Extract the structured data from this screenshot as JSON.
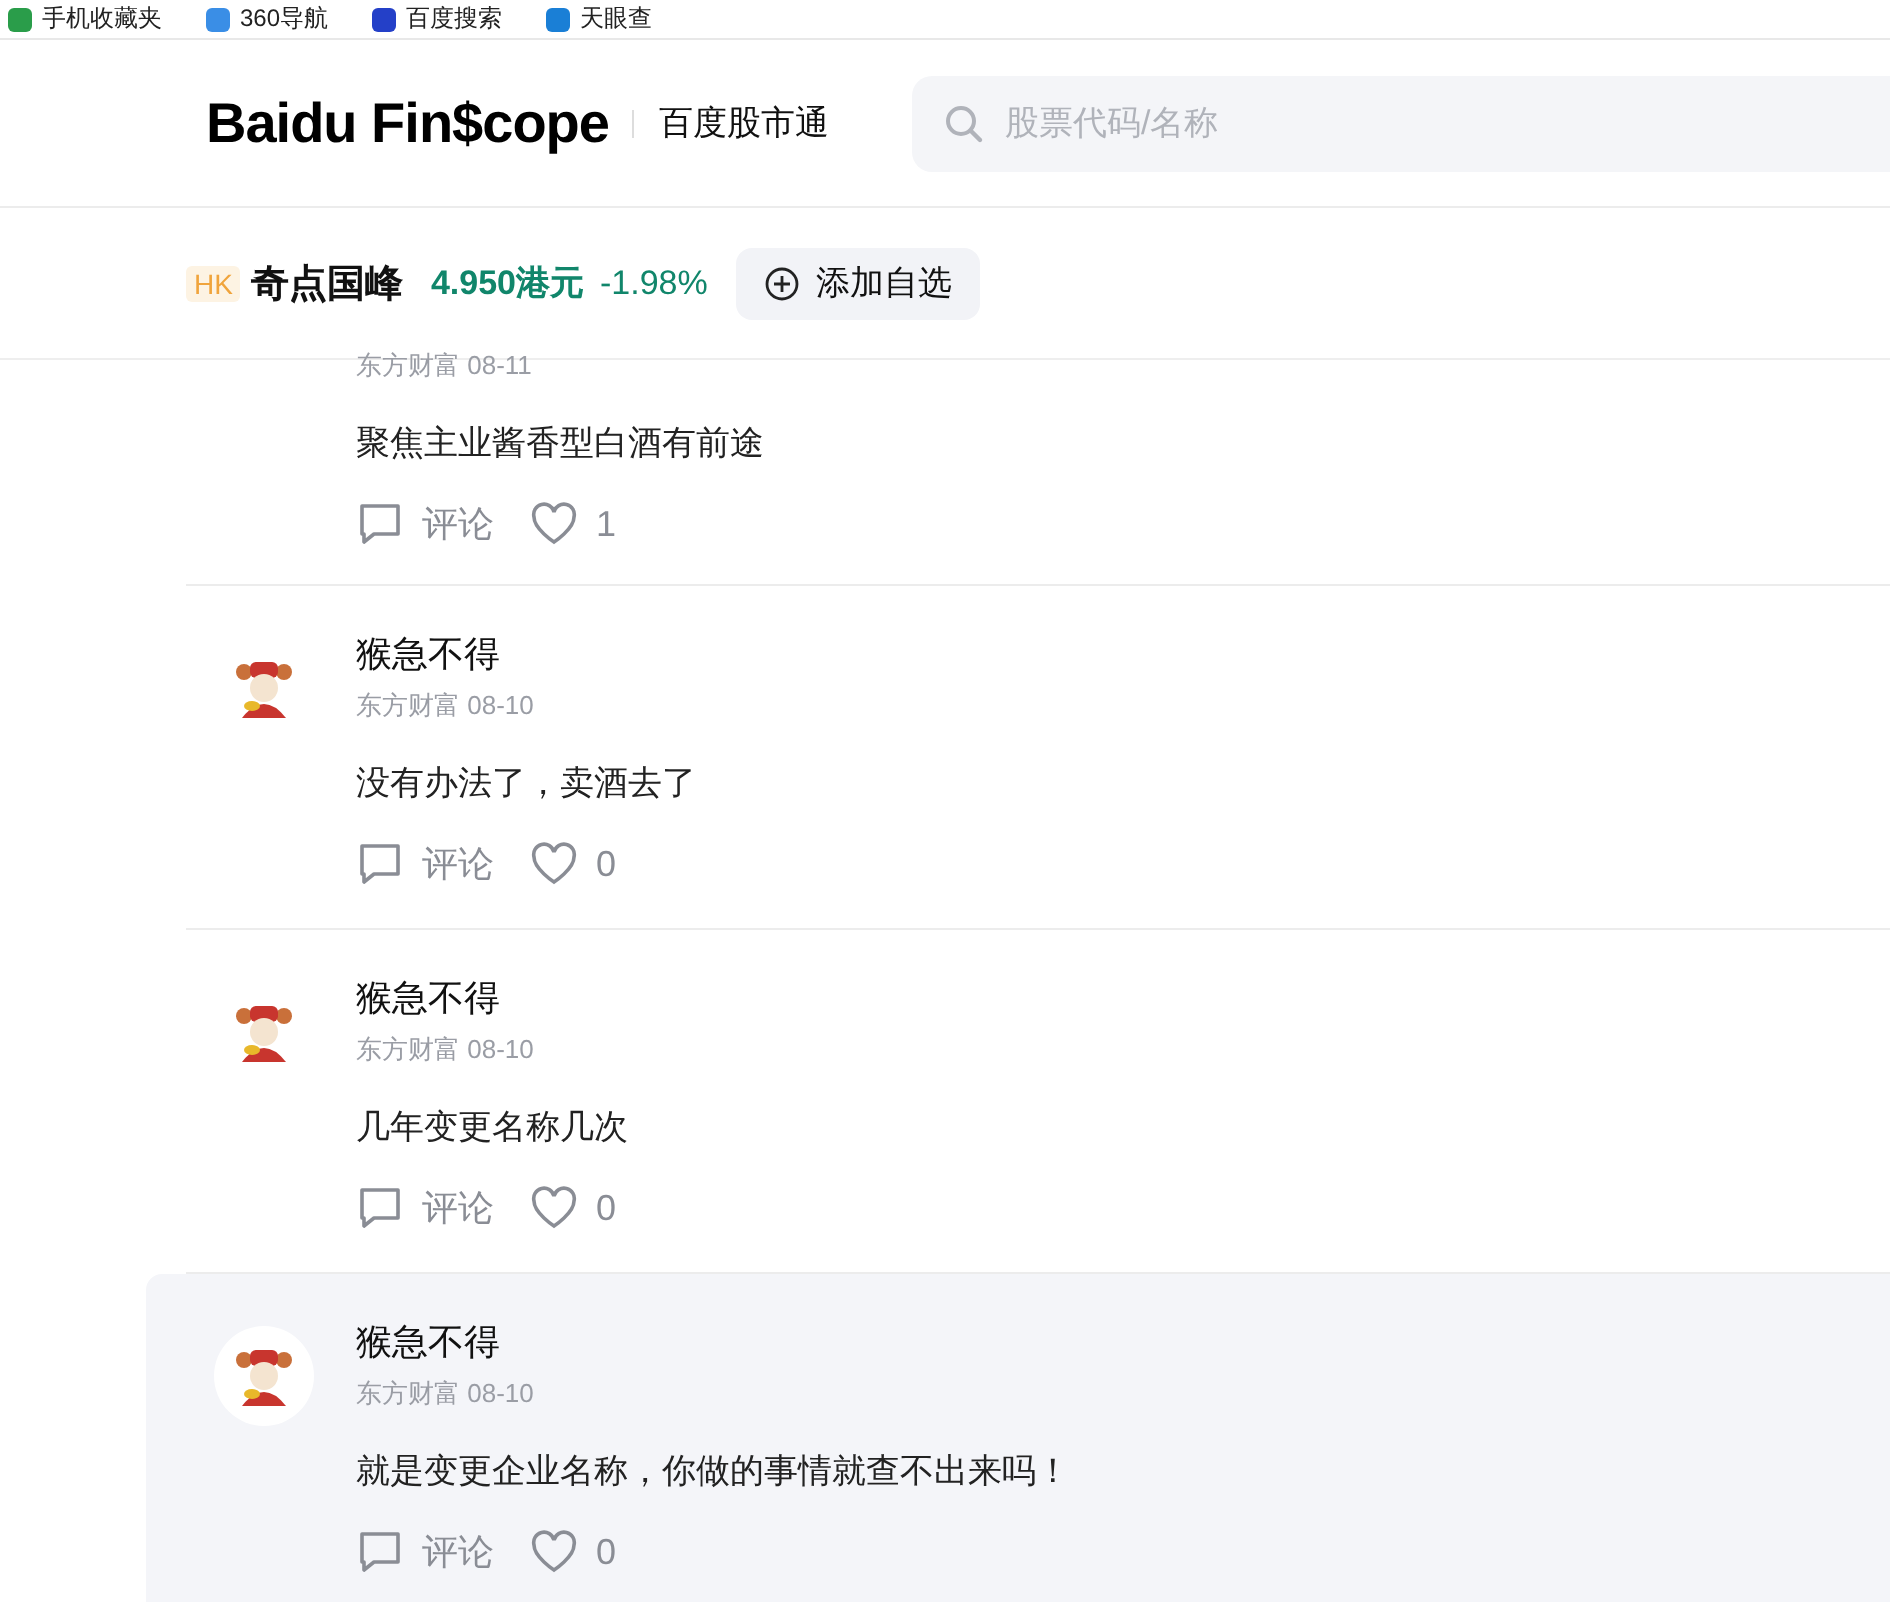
{
  "bookmarks": [
    {
      "label": "手机收藏夹"
    },
    {
      "label": "360导航"
    },
    {
      "label": "百度搜索"
    },
    {
      "label": "天眼查"
    }
  ],
  "header": {
    "logo": "Baidu Fin$cope",
    "product": "百度股市通",
    "search": {
      "placeholder": "股票代码/名称"
    }
  },
  "stock": {
    "market": "HK",
    "name": "奇点国峰",
    "price": "4.950港元",
    "change": "-1.98%",
    "add_button": "添加自选"
  },
  "comments": [
    {
      "source": "东方财富 08-11",
      "text": "聚焦主业酱香型白酒有前途",
      "comment_label": "评论",
      "likes": "1",
      "highlighted": false
    },
    {
      "author": "猴急不得",
      "source": "东方财富 08-10",
      "text": "没有办法了，卖酒去了",
      "comment_label": "评论",
      "likes": "0",
      "highlighted": false
    },
    {
      "author": "猴急不得",
      "source": "东方财富 08-10",
      "text": "几年变更名称几次",
      "comment_label": "评论",
      "likes": "0",
      "highlighted": false
    },
    {
      "author": "猴急不得",
      "source": "东方财富 08-10",
      "text": "就是变更企业名称，你做的事情就查不出来吗！",
      "comment_label": "评论",
      "likes": "0",
      "highlighted": true
    }
  ]
}
